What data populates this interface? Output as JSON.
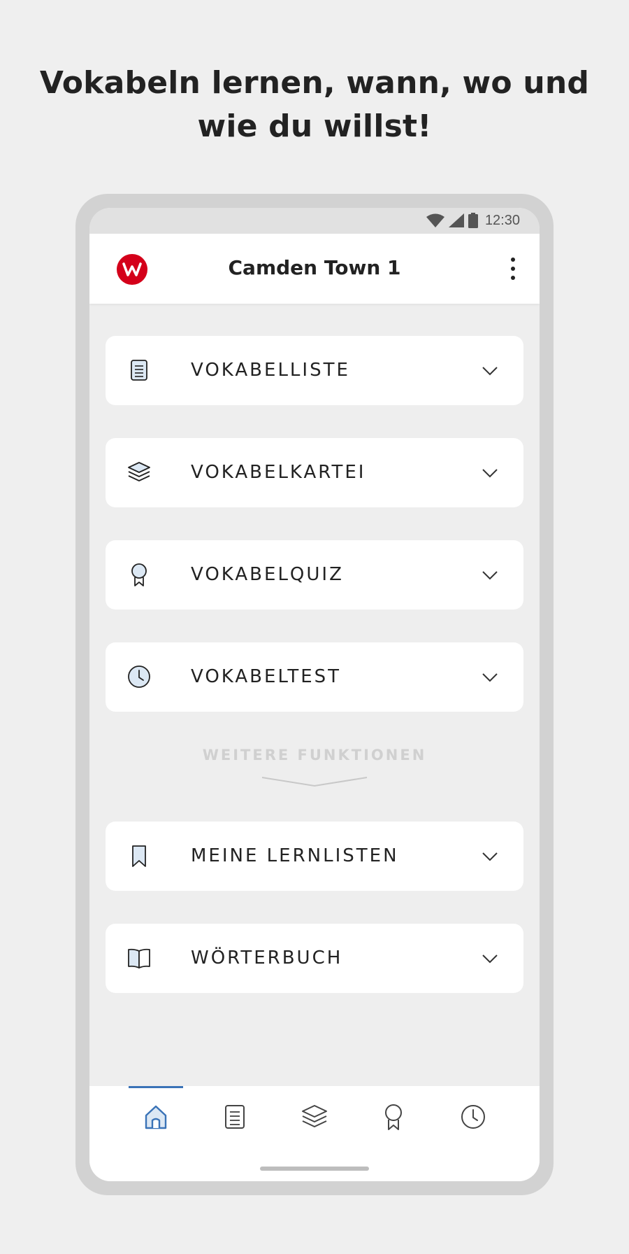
{
  "promo": {
    "headline_line1": "Vokabeln lernen, wann, wo und",
    "headline_line2": "wie du willst!"
  },
  "status_bar": {
    "time": "12:30",
    "icons": [
      "wifi-icon",
      "signal-icon",
      "battery-icon"
    ]
  },
  "app_bar": {
    "logo_letter": "W",
    "title": "Camden Town 1",
    "menu_icon": "more-vert-icon"
  },
  "colors": {
    "brand_red": "#d4001a",
    "accent_blue": "#3a73b7",
    "icon_fill": "#dce8f4"
  },
  "main_menu": [
    {
      "label": "VOKABELLISTE",
      "icon": "list-document-icon"
    },
    {
      "label": "VOKABELKARTEI",
      "icon": "layers-icon"
    },
    {
      "label": "VOKABELQUIZ",
      "icon": "award-icon"
    },
    {
      "label": "VOKABELTEST",
      "icon": "clock-icon"
    }
  ],
  "more_section": {
    "label": "WEITERE FUNKTIONEN"
  },
  "more_menu": [
    {
      "label": "MEINE LERNLISTEN",
      "icon": "bookmark-icon"
    },
    {
      "label": "WÖRTERBUCH",
      "icon": "book-icon"
    }
  ],
  "bottom_nav": {
    "active_index": 0,
    "items": [
      "home-icon",
      "list-document-icon",
      "layers-icon",
      "award-icon",
      "clock-icon"
    ]
  }
}
